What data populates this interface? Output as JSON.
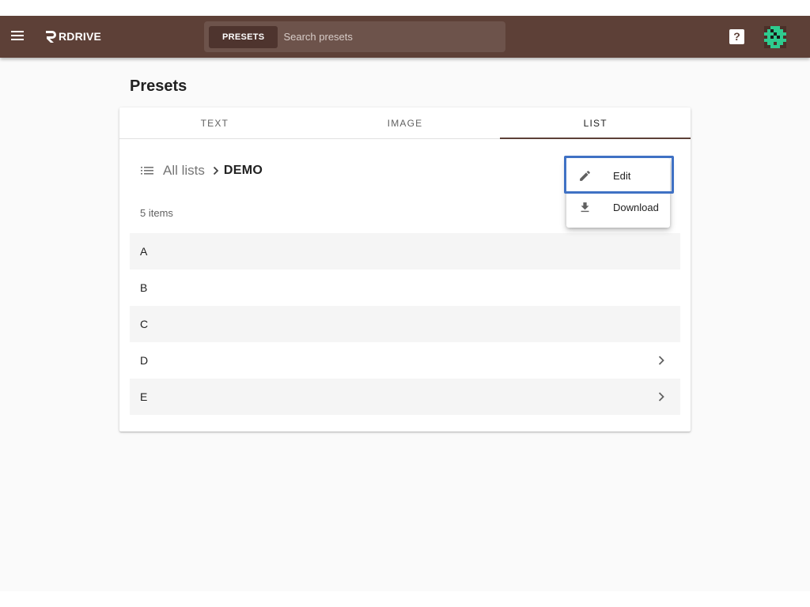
{
  "app": {
    "logo_text": "RDRIVE",
    "search": {
      "scope_label": "PRESETS",
      "placeholder": "Search presets"
    },
    "help_label": "?"
  },
  "page": {
    "title": "Presets"
  },
  "tabs": [
    {
      "label": "TEXT",
      "active": false
    },
    {
      "label": "IMAGE",
      "active": false
    },
    {
      "label": "LIST",
      "active": true
    }
  ],
  "breadcrumb": {
    "root": "All lists",
    "current": "DEMO"
  },
  "list": {
    "count_text": "5 items",
    "items": [
      {
        "label": "A",
        "has_children": false
      },
      {
        "label": "B",
        "has_children": false
      },
      {
        "label": "C",
        "has_children": false
      },
      {
        "label": "D",
        "has_children": true
      },
      {
        "label": "E",
        "has_children": true
      }
    ]
  },
  "context_menu": {
    "items": [
      {
        "label": "Edit",
        "icon": "pencil-icon",
        "highlighted": true
      },
      {
        "label": "Download",
        "icon": "download-icon",
        "highlighted": false
      }
    ]
  },
  "colors": {
    "appbar": "#5d4037",
    "highlight": "#3f71c4",
    "avatar": "#2ecc8f"
  }
}
